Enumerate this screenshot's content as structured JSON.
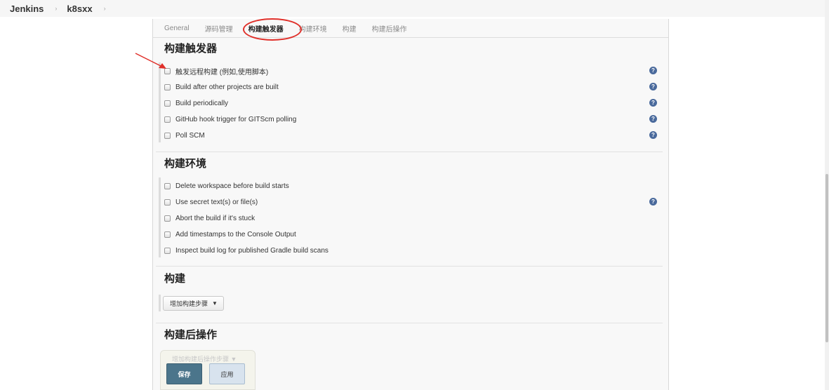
{
  "breadcrumb": {
    "items": [
      "Jenkins",
      "k8sxx"
    ],
    "separator": "›"
  },
  "tabs": [
    "General",
    "源码管理",
    "构建触发器",
    "构建环境",
    "构建",
    "构建后操作"
  ],
  "active_tab": "构建触发器",
  "sections": {
    "triggers": {
      "title": "构建触发器",
      "options": [
        "触发远程构建 (例如,使用脚本)",
        "Build after other projects are built",
        "Build periodically",
        "GitHub hook trigger for GITScm polling",
        "Poll SCM"
      ]
    },
    "environment": {
      "title": "构建环境",
      "options": [
        "Delete workspace before build starts",
        "Use secret text(s) or file(s)",
        "Abort the build if it's stuck",
        "Add timestamps to the Console Output",
        "Inspect build log for published Gradle build scans"
      ]
    },
    "build": {
      "title": "构建",
      "add_step_label": "增加构建步骤"
    },
    "post_build": {
      "title": "构建后操作",
      "add_step_label": "增加构建后操作步骤"
    }
  },
  "icons": {
    "help": "question-icon",
    "caret": "▼"
  },
  "buttons": {
    "save": "保存",
    "apply": "应用"
  },
  "colors": {
    "annotation_red": "#e0302a",
    "save_button": "#4b758b",
    "apply_button": "#d8e3ee",
    "help_icon": "#4a6a9c"
  }
}
